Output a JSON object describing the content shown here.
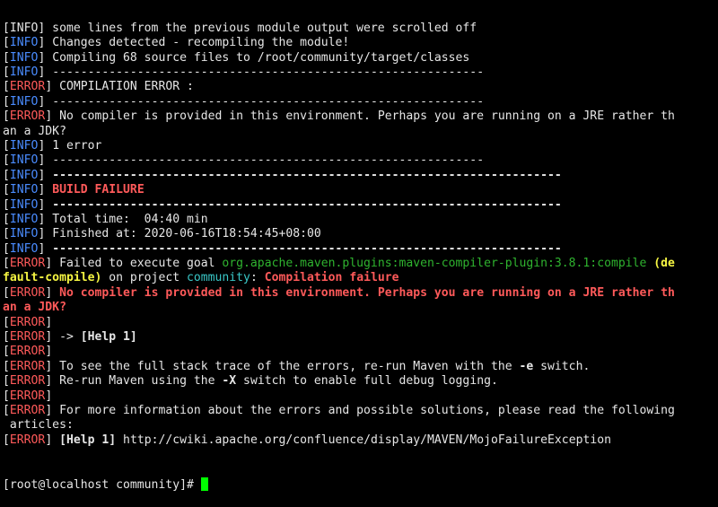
{
  "terminal": {
    "lines": [
      [
        {
          "t": "[INFO] some lines from the previous module output were scrolled off",
          "c": ""
        }
      ],
      [
        {
          "t": "[",
          "c": ""
        },
        {
          "t": "INFO",
          "c": "b"
        },
        {
          "t": "] Changes detected - recompiling the module!",
          "c": ""
        }
      ],
      [
        {
          "t": "[",
          "c": ""
        },
        {
          "t": "INFO",
          "c": "b"
        },
        {
          "t": "] Compiling 68 source files to /root/community/target/classes",
          "c": ""
        }
      ],
      [
        {
          "t": "[",
          "c": ""
        },
        {
          "t": "INFO",
          "c": "b"
        },
        {
          "t": "] -------------------------------------------------------------",
          "c": ""
        }
      ],
      [
        {
          "t": "[",
          "c": ""
        },
        {
          "t": "ERROR",
          "c": "r"
        },
        {
          "t": "] COMPILATION ERROR :",
          "c": ""
        }
      ],
      [
        {
          "t": "[",
          "c": ""
        },
        {
          "t": "INFO",
          "c": "b"
        },
        {
          "t": "] -------------------------------------------------------------",
          "c": ""
        }
      ],
      [
        {
          "t": "[",
          "c": ""
        },
        {
          "t": "ERROR",
          "c": "r"
        },
        {
          "t": "] No compiler is provided in this environment. Perhaps you are running on a JRE rather th",
          "c": ""
        }
      ],
      [
        {
          "t": "an a JDK?",
          "c": ""
        }
      ],
      [
        {
          "t": "[",
          "c": ""
        },
        {
          "t": "INFO",
          "c": "b"
        },
        {
          "t": "] 1 error",
          "c": ""
        }
      ],
      [
        {
          "t": "[",
          "c": ""
        },
        {
          "t": "INFO",
          "c": "b"
        },
        {
          "t": "] -------------------------------------------------------------",
          "c": ""
        }
      ],
      [
        {
          "t": "[",
          "c": ""
        },
        {
          "t": "INFO",
          "c": "b"
        },
        {
          "t": "] ",
          "c": ""
        },
        {
          "t": "------------------------------------------------------------------------",
          "c": "bold"
        }
      ],
      [
        {
          "t": "[",
          "c": ""
        },
        {
          "t": "INFO",
          "c": "b"
        },
        {
          "t": "] ",
          "c": ""
        },
        {
          "t": "BUILD FAILURE",
          "c": "r bold"
        }
      ],
      [
        {
          "t": "[",
          "c": ""
        },
        {
          "t": "INFO",
          "c": "b"
        },
        {
          "t": "] ",
          "c": ""
        },
        {
          "t": "------------------------------------------------------------------------",
          "c": "bold"
        }
      ],
      [
        {
          "t": "[",
          "c": ""
        },
        {
          "t": "INFO",
          "c": "b"
        },
        {
          "t": "] Total time:  04:40 min",
          "c": ""
        }
      ],
      [
        {
          "t": "[",
          "c": ""
        },
        {
          "t": "INFO",
          "c": "b"
        },
        {
          "t": "] Finished at: 2020-06-16T18:54:45+08:00",
          "c": ""
        }
      ],
      [
        {
          "t": "[",
          "c": ""
        },
        {
          "t": "INFO",
          "c": "b"
        },
        {
          "t": "] ",
          "c": ""
        },
        {
          "t": "------------------------------------------------------------------------",
          "c": "bold"
        }
      ],
      [
        {
          "t": "[",
          "c": ""
        },
        {
          "t": "ERROR",
          "c": "r"
        },
        {
          "t": "] Failed to execute goal ",
          "c": ""
        },
        {
          "t": "org.apache.maven.plugins:maven-compiler-plugin:3.8.1:compile",
          "c": "g"
        },
        {
          "t": " ",
          "c": ""
        },
        {
          "t": "(de",
          "c": "y bold"
        }
      ],
      [
        {
          "t": "fault-compile)",
          "c": "y bold"
        },
        {
          "t": " on project ",
          "c": ""
        },
        {
          "t": "community",
          "c": "c"
        },
        {
          "t": ": ",
          "c": ""
        },
        {
          "t": "Compilation failure",
          "c": "r bold"
        }
      ],
      [
        {
          "t": "[",
          "c": ""
        },
        {
          "t": "ERROR",
          "c": "r"
        },
        {
          "t": "] ",
          "c": ""
        },
        {
          "t": "No compiler is provided in this environment. Perhaps you are running on a JRE rather th",
          "c": "r bold"
        }
      ],
      [
        {
          "t": "an a JDK?",
          "c": "r bold"
        }
      ],
      [
        {
          "t": "[",
          "c": ""
        },
        {
          "t": "ERROR",
          "c": "r"
        },
        {
          "t": "]",
          "c": ""
        }
      ],
      [
        {
          "t": "[",
          "c": ""
        },
        {
          "t": "ERROR",
          "c": "r"
        },
        {
          "t": "] -> ",
          "c": ""
        },
        {
          "t": "[Help 1]",
          "c": "bold"
        }
      ],
      [
        {
          "t": "[",
          "c": ""
        },
        {
          "t": "ERROR",
          "c": "r"
        },
        {
          "t": "]",
          "c": ""
        }
      ],
      [
        {
          "t": "[",
          "c": ""
        },
        {
          "t": "ERROR",
          "c": "r"
        },
        {
          "t": "] To see the full stack trace of the errors, re-run Maven with the ",
          "c": ""
        },
        {
          "t": "-e",
          "c": "bold"
        },
        {
          "t": " switch.",
          "c": ""
        }
      ],
      [
        {
          "t": "[",
          "c": ""
        },
        {
          "t": "ERROR",
          "c": "r"
        },
        {
          "t": "] Re-run Maven using the ",
          "c": ""
        },
        {
          "t": "-X",
          "c": "bold"
        },
        {
          "t": " switch to enable full debug logging.",
          "c": ""
        }
      ],
      [
        {
          "t": "[",
          "c": ""
        },
        {
          "t": "ERROR",
          "c": "r"
        },
        {
          "t": "]",
          "c": ""
        }
      ],
      [
        {
          "t": "[",
          "c": ""
        },
        {
          "t": "ERROR",
          "c": "r"
        },
        {
          "t": "] For more information about the errors and possible solutions, please read the following",
          "c": ""
        }
      ],
      [
        {
          "t": " articles:",
          "c": ""
        }
      ],
      [
        {
          "t": "[",
          "c": ""
        },
        {
          "t": "ERROR",
          "c": "r"
        },
        {
          "t": "] ",
          "c": ""
        },
        {
          "t": "[Help 1]",
          "c": "bold"
        },
        {
          "t": " http://cwiki.apache.org/confluence/display/MAVEN/MojoFailureException",
          "c": ""
        }
      ]
    ],
    "prompt": "[root@localhost community]# ",
    "colors": {
      "background": "#000000",
      "text": "#e6e6e6",
      "info": "#4a8cff",
      "error": "#ff5a5a",
      "goal": "#2fb42f",
      "project": "#39c7c7",
      "execution": "#f5f542",
      "cursor": "#00ff00"
    }
  }
}
